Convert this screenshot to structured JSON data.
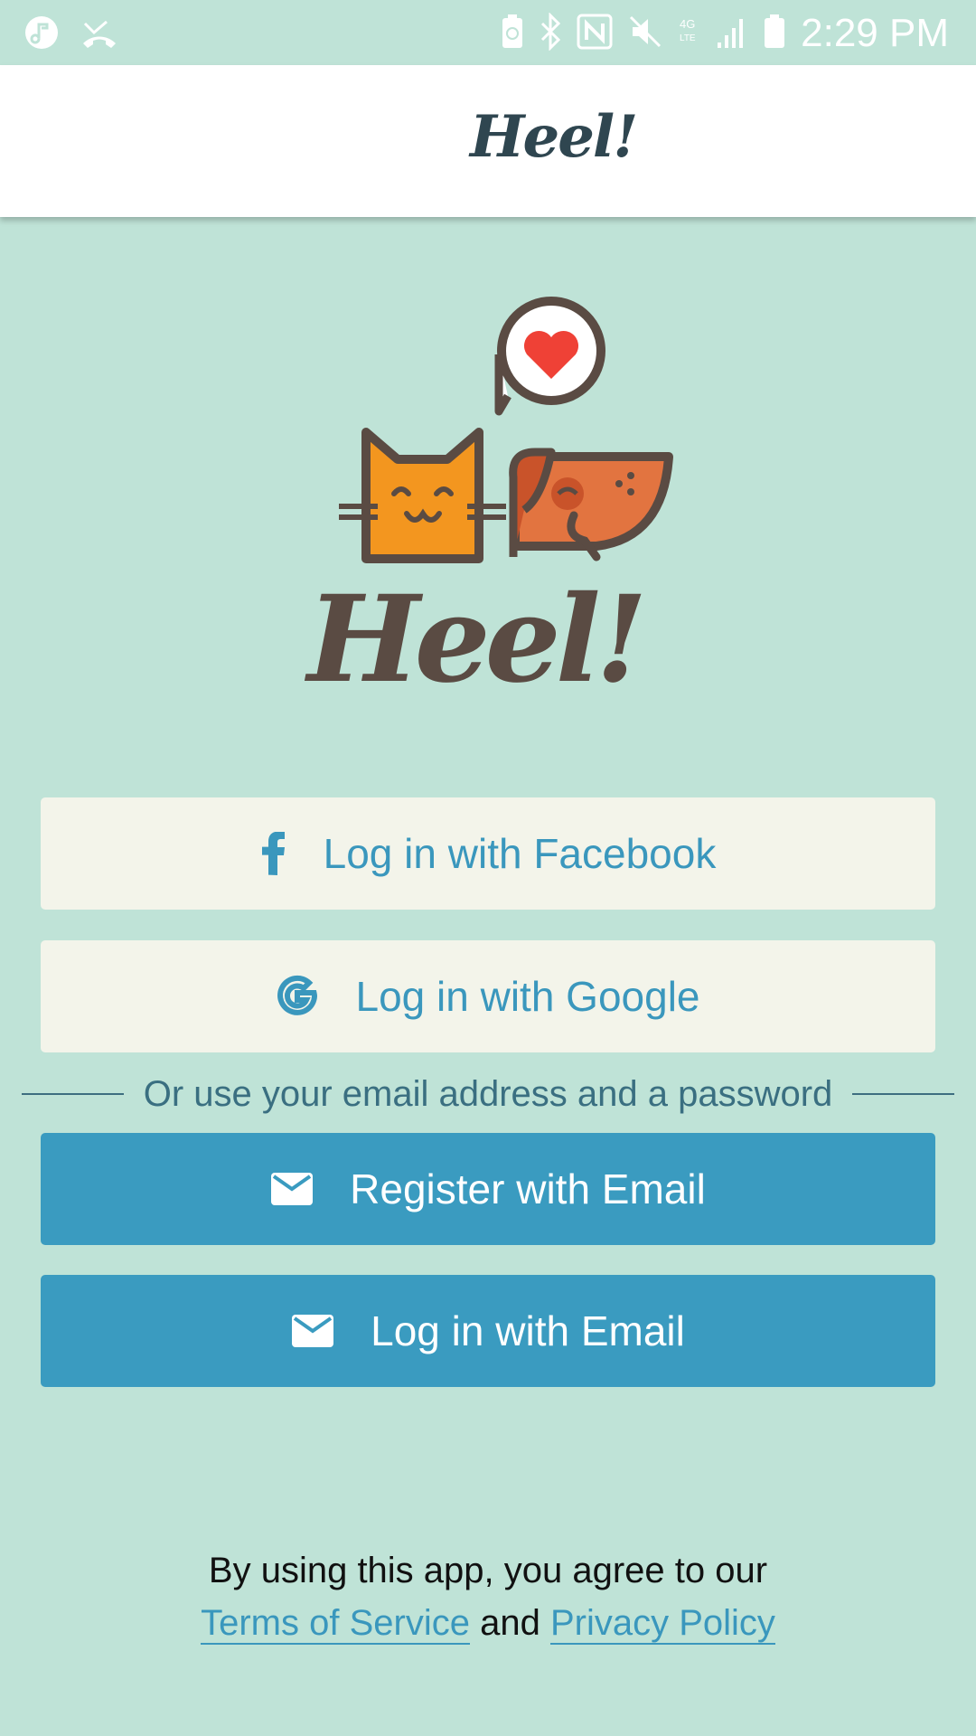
{
  "status_bar": {
    "time": "2:29 PM",
    "left_icons": [
      "music-icon",
      "missed-call-icon"
    ],
    "right_icons": [
      "battery-saver-icon",
      "bluetooth-icon",
      "nfc-icon",
      "mute-icon",
      "lte-icon",
      "signal-icon",
      "battery-icon"
    ]
  },
  "app_bar": {
    "title": "Heel!"
  },
  "logo": {
    "wordmark": "Heel!"
  },
  "buttons": {
    "facebook": "Log in with Facebook",
    "google": "Log in with Google",
    "register_email": "Register with Email",
    "login_email": "Log in with Email"
  },
  "divider_text": "Or use your email address and a password",
  "legal": {
    "line1": "By using this app, you agree to our",
    "terms": "Terms of Service",
    "and": "and",
    "privacy": "Privacy Policy"
  },
  "colors": {
    "background": "#bfe3d7",
    "light_button": "#f3f4ea",
    "accent": "#3a9bc0",
    "brand_dark": "#5a4b43",
    "cat_orange": "#f3961f",
    "dog_orange": "#e27440",
    "heart_red": "#ef4136"
  }
}
